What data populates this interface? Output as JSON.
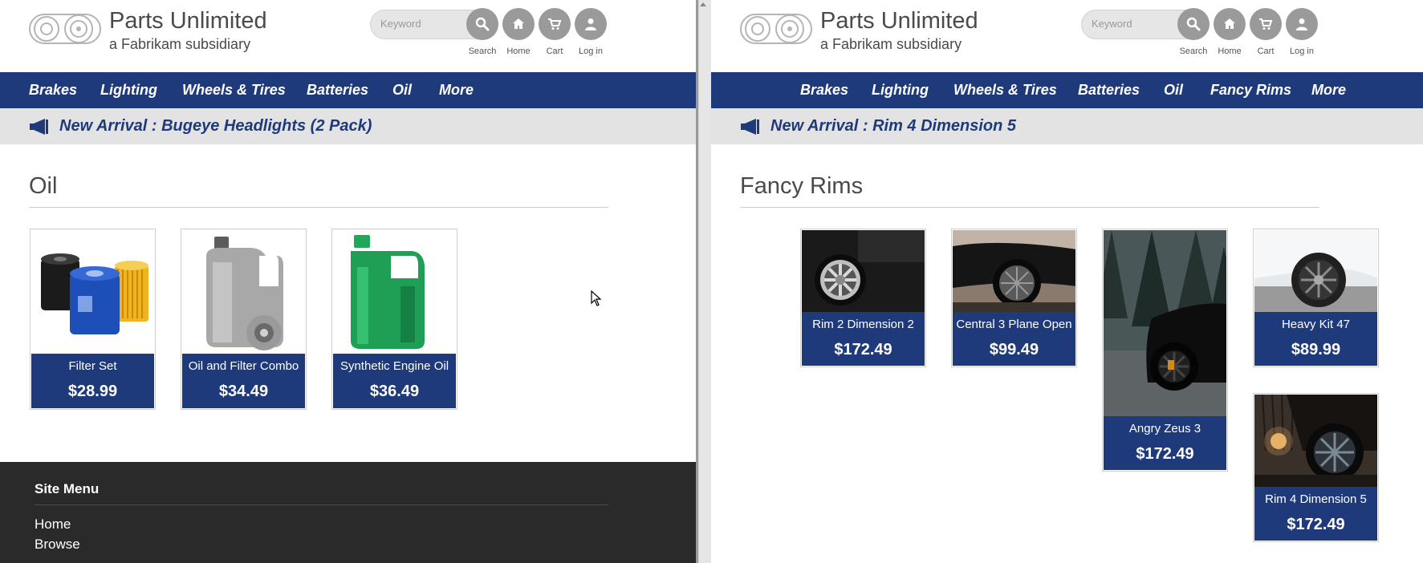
{
  "brand": {
    "title": "Parts Unlimited",
    "subtitle": "a Fabrikam subsidiary"
  },
  "header": {
    "search_placeholder": "Keyword",
    "icon_labels": {
      "search": "Search",
      "home": "Home",
      "cart": "Cart",
      "login": "Log in"
    }
  },
  "colors": {
    "nav_bg": "#1e3a7b",
    "announce_bg": "#e3e3e3",
    "icon_bg": "#9a9a9a",
    "footer_bg": "#2a2a2a"
  },
  "left": {
    "nav": [
      "Brakes",
      "Lighting",
      "Wheels & Tires",
      "Batteries",
      "Oil",
      "More"
    ],
    "announcement": "New Arrival : Bugeye Headlights (2 Pack)",
    "section_title": "Oil",
    "products": [
      {
        "name": "Filter Set",
        "price": "$28.99",
        "image": "oil-filters-image"
      },
      {
        "name": "Oil and Filter Combo",
        "price": "$34.49",
        "image": "oil-jug-image"
      },
      {
        "name": "Synthetic Engine Oil",
        "price": "$36.49",
        "image": "green-oil-can-image"
      }
    ],
    "footer": {
      "title": "Site Menu",
      "links": [
        "Home",
        "Browse"
      ]
    }
  },
  "right": {
    "nav": [
      "Brakes",
      "Lighting",
      "Wheels & Tires",
      "Batteries",
      "Oil",
      "Fancy Rims",
      "More"
    ],
    "announcement": "New Arrival : Rim 4 Dimension 5",
    "section_title": "Fancy Rims",
    "products": [
      {
        "name": "Rim 2 Dimension 2",
        "price": "$172.49",
        "image": "rim-photo"
      },
      {
        "name": "Central 3 Plane Open",
        "price": "$99.49",
        "image": "rim-photo"
      },
      {
        "name": "Angry Zeus 3",
        "price": "$172.49",
        "image": "car-in-forest-photo"
      },
      {
        "name": "Heavy Kit 47",
        "price": "$89.99",
        "image": "white-car-rim-photo"
      },
      {
        "name": "Rim 4 Dimension 5",
        "price": "$172.49",
        "image": "rim-at-dusk-photo"
      }
    ]
  }
}
